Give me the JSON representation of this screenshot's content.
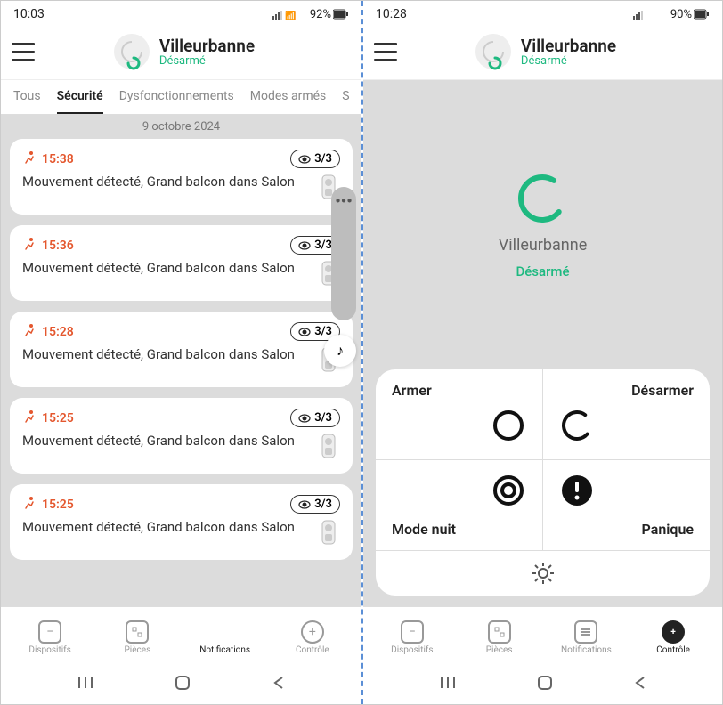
{
  "left": {
    "status_time": "10:03",
    "battery": "92%",
    "header": {
      "title": "Villeurbanne",
      "subtitle": "Désarmé"
    },
    "tabs": {
      "t0": "Tous",
      "t1": "Sécurité",
      "t2": "Dysfonctionnements",
      "t3": "Modes armés",
      "t4": "S"
    },
    "date_heading": "9 octobre 2024",
    "events": [
      {
        "time": "15:38",
        "photos": "3/3",
        "desc": "Mouvement détecté, Grand balcon dans Salon"
      },
      {
        "time": "15:36",
        "photos": "3/3",
        "desc": "Mouvement détecté, Grand balcon dans Salon"
      },
      {
        "time": "15:28",
        "photos": "3/3",
        "desc": "Mouvement détecté, Grand balcon dans Salon"
      },
      {
        "time": "15:25",
        "photos": "3/3",
        "desc": "Mouvement détecté, Grand balcon dans Salon"
      },
      {
        "time": "15:25",
        "photos": "3/3",
        "desc": "Mouvement détecté, Grand balcon dans Salon"
      }
    ],
    "nav": {
      "n0": "Dispositifs",
      "n1": "Pièces",
      "n2": "Notifications",
      "n3": "Contrôle"
    }
  },
  "right": {
    "status_time": "10:28",
    "battery": "90%",
    "header": {
      "title": "Villeurbanne",
      "subtitle": "Désarmé"
    },
    "hub": {
      "name": "Villeurbanne",
      "state": "Désarmé"
    },
    "controls": {
      "arm": "Armer",
      "disarm": "Désarmer",
      "night": "Mode nuit",
      "panic": "Panique"
    },
    "nav": {
      "n0": "Dispositifs",
      "n1": "Pièces",
      "n2": "Notifications",
      "n3": "Contrôle"
    }
  }
}
